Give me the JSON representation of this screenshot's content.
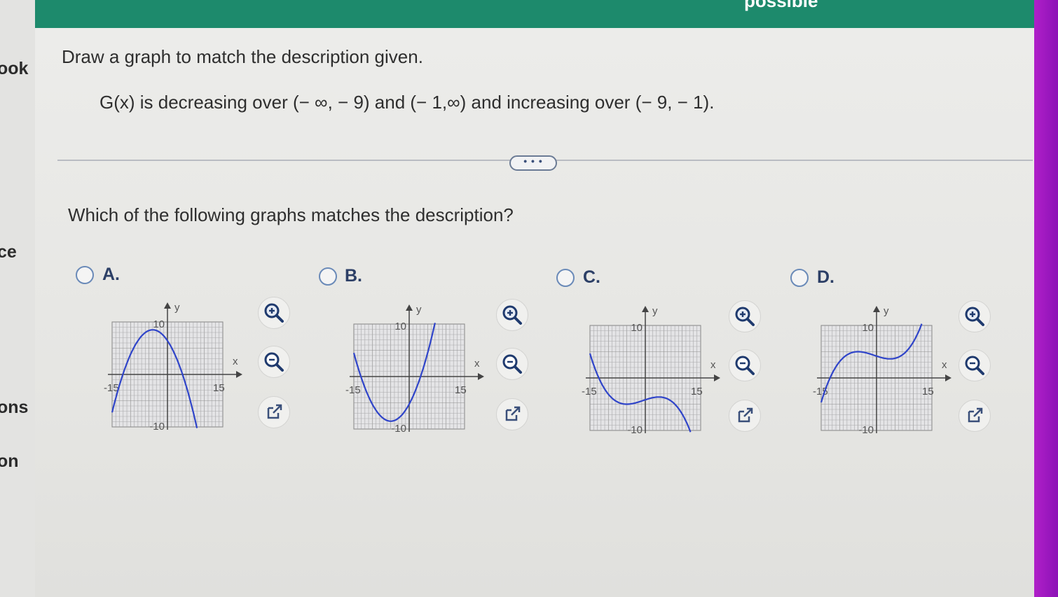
{
  "sidebar": {
    "labels": [
      "ook",
      "ce",
      "ons",
      "on"
    ]
  },
  "topbar": {
    "text": "possible"
  },
  "problem": {
    "instruction": "Draw a graph to match the description given.",
    "description": "G(x) is decreasing over (− ∞, − 9) and (− 1,∞) and increasing over (− 9, − 1).",
    "more_label": "• • •",
    "question": "Which of the following graphs matches the description?"
  },
  "options": [
    {
      "letter": "A.",
      "axis_y": "y",
      "axis_x": "x",
      "y_max": "10",
      "y_min": "-10",
      "x_min": "-15",
      "x_max": "15",
      "shape": "downward-parabola"
    },
    {
      "letter": "B.",
      "axis_y": "y",
      "axis_x": "x",
      "y_max": "10",
      "y_min": "-10",
      "x_min": "-15",
      "x_max": "15",
      "shape": "upward-parabola"
    },
    {
      "letter": "C.",
      "axis_y": "y",
      "axis_x": "x",
      "y_max": "10",
      "y_min": "-10",
      "x_min": "-15",
      "x_max": "15",
      "shape": "cubic-down-min-left-max-right"
    },
    {
      "letter": "D.",
      "axis_y": "y",
      "axis_x": "x",
      "y_max": "10",
      "y_min": "-10",
      "x_min": "-15",
      "x_max": "15",
      "shape": "cubic-up-max-left-min-right"
    }
  ],
  "icons": [
    "zoom-in-icon",
    "zoom-out-icon",
    "external-link-icon"
  ],
  "colors": {
    "topbar": "#1d8a6c",
    "curve": "#2f44c9",
    "radio": "#6a8ab8",
    "accent_purple": "#a01ac4"
  }
}
